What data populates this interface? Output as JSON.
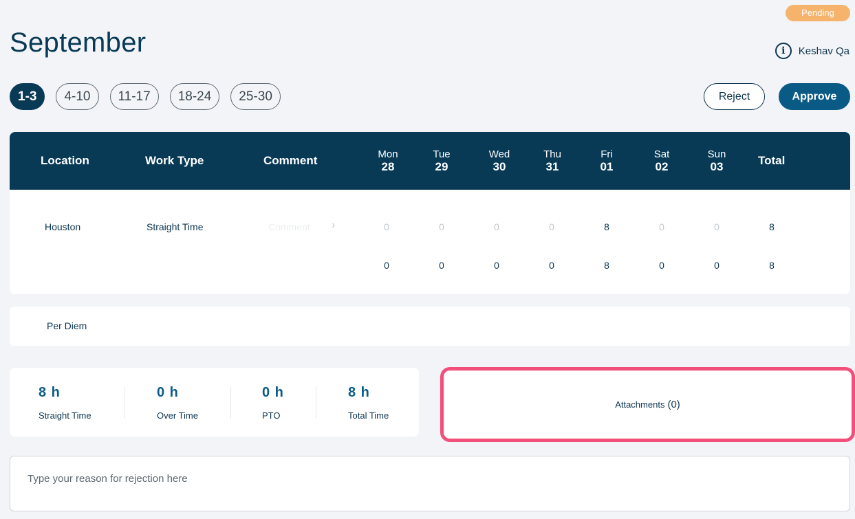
{
  "status": "Pending",
  "page_title": "September",
  "user": {
    "name": "Keshav Qa",
    "icon": "info-icon"
  },
  "week_tabs": [
    "1-3",
    "4-10",
    "11-17",
    "18-24",
    "25-30"
  ],
  "actions": {
    "reject_label": "Reject",
    "approve_label": "Approve"
  },
  "table": {
    "headers": {
      "location": "Location",
      "work_type": "Work Type",
      "comment": "Comment",
      "total": "Total"
    },
    "days": [
      {
        "name": "Mon",
        "num": "28"
      },
      {
        "name": "Tue",
        "num": "29"
      },
      {
        "name": "Wed",
        "num": "30"
      },
      {
        "name": "Thu",
        "num": "31"
      },
      {
        "name": "Fri",
        "num": "01"
      },
      {
        "name": "Sat",
        "num": "02"
      },
      {
        "name": "Sun",
        "num": "03"
      }
    ],
    "row": {
      "location": "Houston",
      "work_type": "Straight Time",
      "comment_placeholder": "Comment",
      "hours": [
        "0",
        "0",
        "0",
        "0",
        "8",
        "0",
        "0"
      ],
      "total": "8"
    },
    "totals": {
      "hours": [
        "0",
        "0",
        "0",
        "0",
        "8",
        "0",
        "0"
      ],
      "total": "8"
    }
  },
  "per_diem_label": "Per Diem",
  "summary": [
    {
      "value": "8 h",
      "label": "Straight Time"
    },
    {
      "value": "0 h",
      "label": "Over Time"
    },
    {
      "value": "0 h",
      "label": "PTO"
    },
    {
      "value": "8 h",
      "label": "Total Time"
    }
  ],
  "attachments": {
    "label": "Attachments",
    "count": "(0)"
  },
  "rejection_placeholder": "Type your reason for rejection here",
  "colors": {
    "primary": "#083a56",
    "accent": "#0a5a86",
    "pending": "#f6b36b",
    "highlight": "#f2507a"
  }
}
